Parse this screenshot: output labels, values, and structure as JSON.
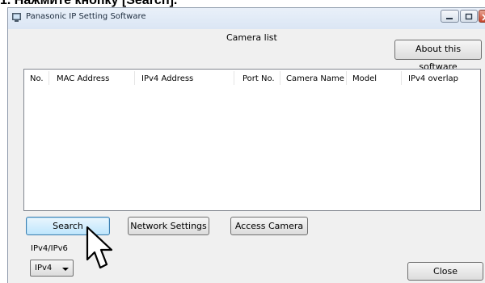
{
  "caption": "1. Нажмите кнопку [Search].",
  "window": {
    "title": "Panasonic IP Setting Software"
  },
  "camera_list_label": "Camera list",
  "about_label": "About this software",
  "table": {
    "headers": [
      "No.",
      "MAC Address",
      "IPv4 Address",
      "Port No.",
      "Camera Name",
      "Model",
      "IPv4 overlap"
    ]
  },
  "buttons": {
    "search": "Search",
    "network_settings": "Network Settings",
    "access_camera": "Access Camera",
    "close": "Close"
  },
  "ip_mode": {
    "label": "IPv4/IPv6",
    "selected": "IPv4"
  },
  "icons": [
    "app-icon",
    "minimize-icon",
    "maximize-icon",
    "close-icon",
    "mouse-pointer-icon",
    "chevron-down-icon"
  ]
}
